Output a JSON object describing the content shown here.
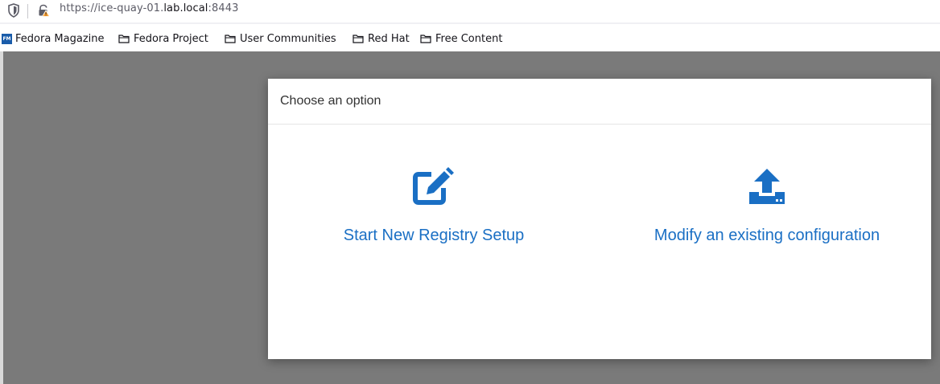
{
  "browser": {
    "url_prefix": "https://ice-quay-01.",
    "url_host": "lab.local",
    "url_suffix": ":8443"
  },
  "bookmarks": [
    {
      "label": "Fedora Magazine",
      "icon": "fedora-magazine-icon"
    },
    {
      "label": "Fedora Project",
      "icon": "folder-icon"
    },
    {
      "label": "User Communities",
      "icon": "folder-icon"
    },
    {
      "label": "Red Hat",
      "icon": "folder-icon"
    },
    {
      "label": "Free Content",
      "icon": "folder-icon"
    }
  ],
  "modal": {
    "title": "Choose an option",
    "options": [
      {
        "label": "Start New Registry Setup",
        "icon": "edit-icon"
      },
      {
        "label": "Modify an existing configuration",
        "icon": "upload-icon"
      }
    ]
  },
  "colors": {
    "accent": "#1a6fc4",
    "backdrop": "#7a7a7a"
  }
}
